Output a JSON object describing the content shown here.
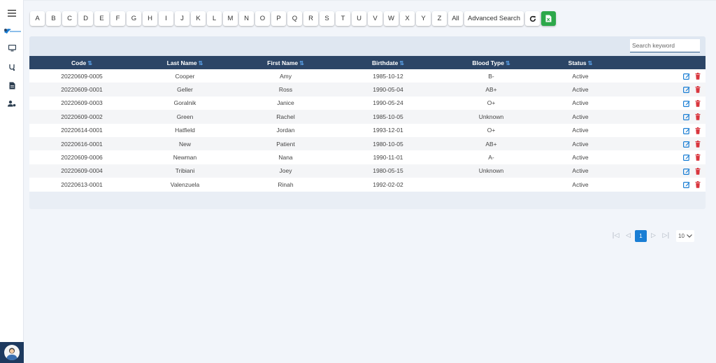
{
  "alphabet": [
    "A",
    "B",
    "C",
    "D",
    "E",
    "F",
    "G",
    "H",
    "I",
    "J",
    "K",
    "L",
    "M",
    "N",
    "O",
    "P",
    "Q",
    "R",
    "S",
    "T",
    "U",
    "V",
    "W",
    "X",
    "Y",
    "Z",
    "All"
  ],
  "toolbar": {
    "advanced_search_label": "Advanced Search",
    "refresh_icon": "refresh-icon",
    "export_icon": "excel-export-icon",
    "export_color": "#2da84a"
  },
  "search": {
    "placeholder": "Search keyword",
    "value": ""
  },
  "table": {
    "header_color": "#2c4566",
    "columns": [
      "Code",
      "Last Name",
      "First Name",
      "Birthdate",
      "Blood Type",
      "Status"
    ],
    "rows": [
      {
        "code": "20220609-0005",
        "last": "Cooper",
        "first": "Amy",
        "birthdate": "1985-10-12",
        "blood": "B-",
        "status": "Active"
      },
      {
        "code": "20220609-0001",
        "last": "Geller",
        "first": "Ross",
        "birthdate": "1990-05-04",
        "blood": "AB+",
        "status": "Active"
      },
      {
        "code": "20220609-0003",
        "last": "Goralnik",
        "first": "Janice",
        "birthdate": "1990-05-24",
        "blood": "O+",
        "status": "Active"
      },
      {
        "code": "20220609-0002",
        "last": "Green",
        "first": "Rachel",
        "birthdate": "1985-10-05",
        "blood": "Unknown",
        "status": "Active"
      },
      {
        "code": "20220614-0001",
        "last": "Hatfield",
        "first": "Jordan",
        "birthdate": "1993-12-01",
        "blood": "O+",
        "status": "Active"
      },
      {
        "code": "20220616-0001",
        "last": "New",
        "first": "Patient",
        "birthdate": "1980-10-05",
        "blood": "AB+",
        "status": "Active"
      },
      {
        "code": "20220609-0006",
        "last": "Newman",
        "first": "Nana",
        "birthdate": "1990-11-01",
        "blood": "A-",
        "status": "Active"
      },
      {
        "code": "20220609-0004",
        "last": "Tribiani",
        "first": "Joey",
        "birthdate": "1980-05-15",
        "blood": "Unknown",
        "status": "Active"
      },
      {
        "code": "20220613-0001",
        "last": "Valenzuela",
        "first": "Rinah",
        "birthdate": "1992-02-02",
        "blood": "",
        "status": "Active"
      }
    ]
  },
  "pagination": {
    "current_page": "1",
    "page_size": "10",
    "accent": "#1a7ed4"
  },
  "sidebar": {
    "icons": [
      "hamburger-menu-icon",
      "monitor-icon",
      "stethoscope-icon",
      "document-icon",
      "user-gear-icon"
    ]
  },
  "colors": {
    "edit": "#1a7ed4",
    "delete": "#d9363e",
    "sidebar_bottom": "#1e3a5f"
  }
}
